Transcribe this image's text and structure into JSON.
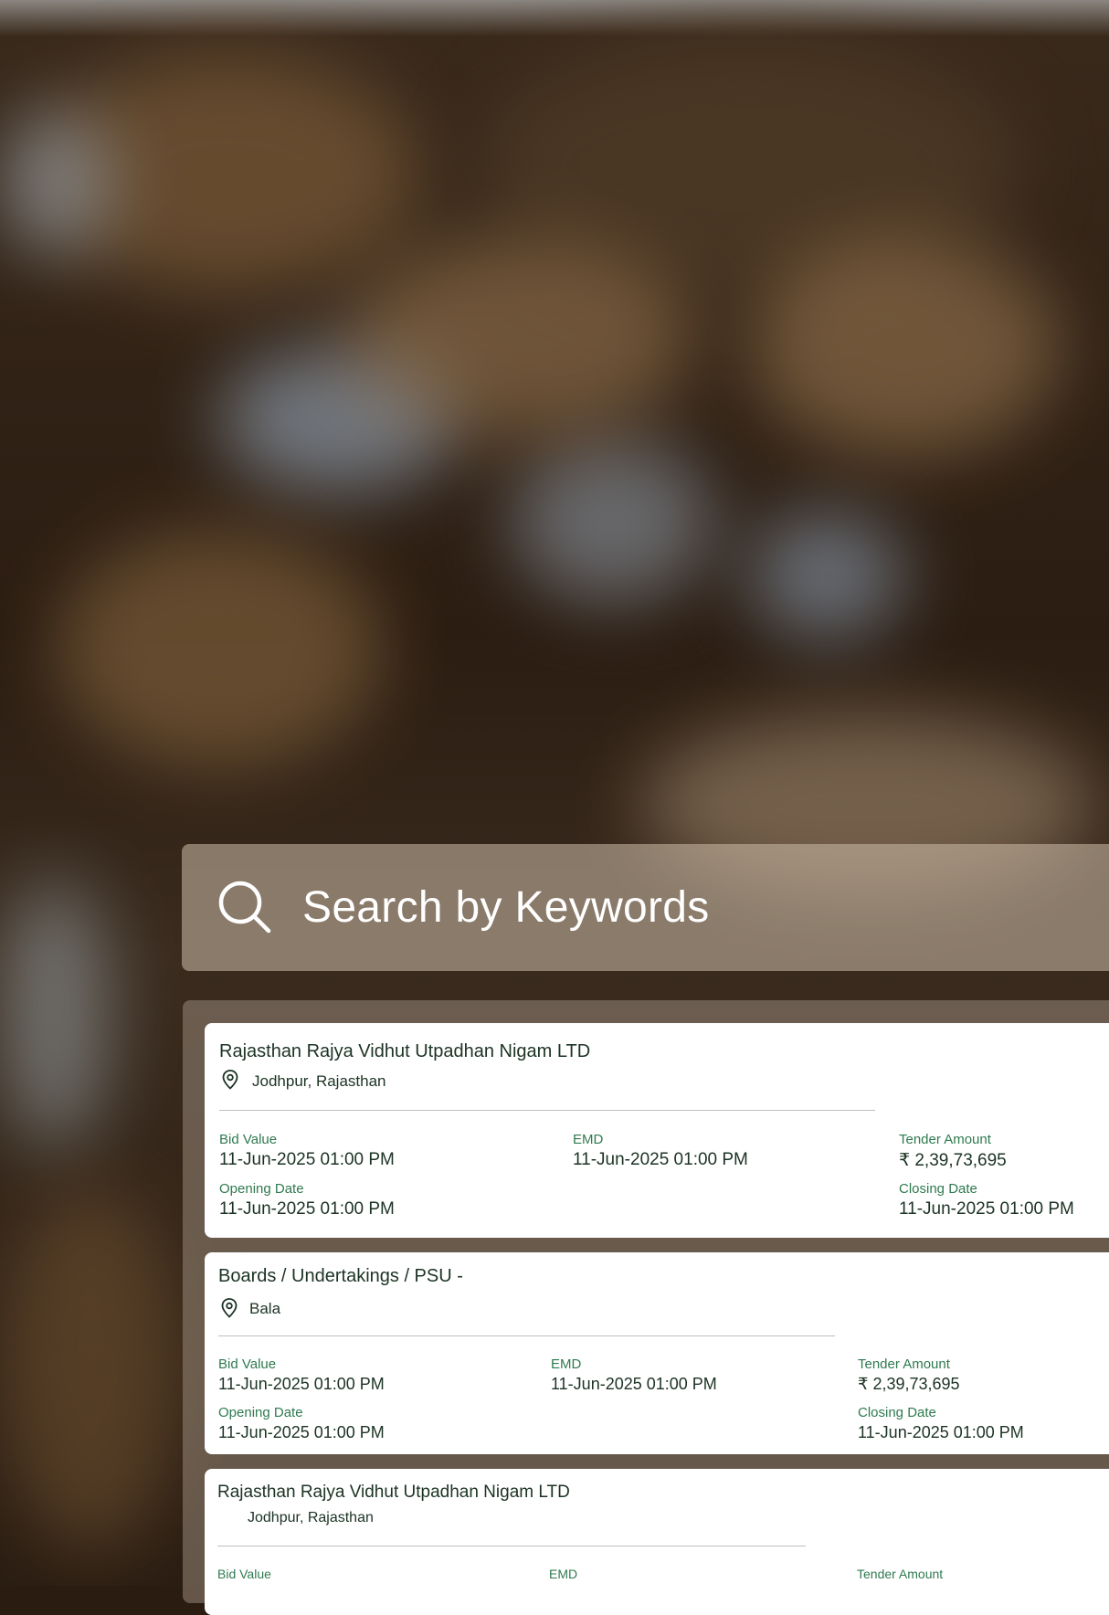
{
  "search": {
    "placeholder": "Search by Keywords"
  },
  "colors": {
    "label": "#2f7a4f",
    "text": "#1c3324",
    "search_text": "#ffffff"
  },
  "results": [
    {
      "org": "Rajasthan Rajya Vidhut Utpadhan Nigam LTD",
      "location": "Jodhpur, Rajasthan",
      "bid_value_label": "Bid Value",
      "bid_value": "11-Jun-2025 01:00 PM",
      "emd_label": "EMD",
      "emd": "11-Jun-2025 01:00 PM",
      "tender_amount_label": "Tender Amount",
      "tender_amount": "₹ 2,39,73,695",
      "opening_date_label": "Opening Date",
      "opening_date": "11-Jun-2025 01:00 PM",
      "closing_date_label": "Closing Date",
      "closing_date": "11-Jun-2025 01:00 PM"
    },
    {
      "org": "Boards / Undertakings / PSU -",
      "location": "Bala",
      "bid_value_label": "Bid Value",
      "bid_value": "11-Jun-2025 01:00 PM",
      "emd_label": "EMD",
      "emd": "11-Jun-2025 01:00 PM",
      "tender_amount_label": "Tender Amount",
      "tender_amount": "₹ 2,39,73,695",
      "opening_date_label": "Opening Date",
      "opening_date": "11-Jun-2025 01:00 PM",
      "closing_date_label": "Closing Date",
      "closing_date": "11-Jun-2025 01:00 PM"
    },
    {
      "org": "Rajasthan Rajya Vidhut Utpadhan Nigam LTD",
      "location": "Jodhpur, Rajasthan",
      "bid_value_label": "Bid Value",
      "emd_label": "EMD",
      "tender_amount_label": "Tender Amount"
    }
  ]
}
